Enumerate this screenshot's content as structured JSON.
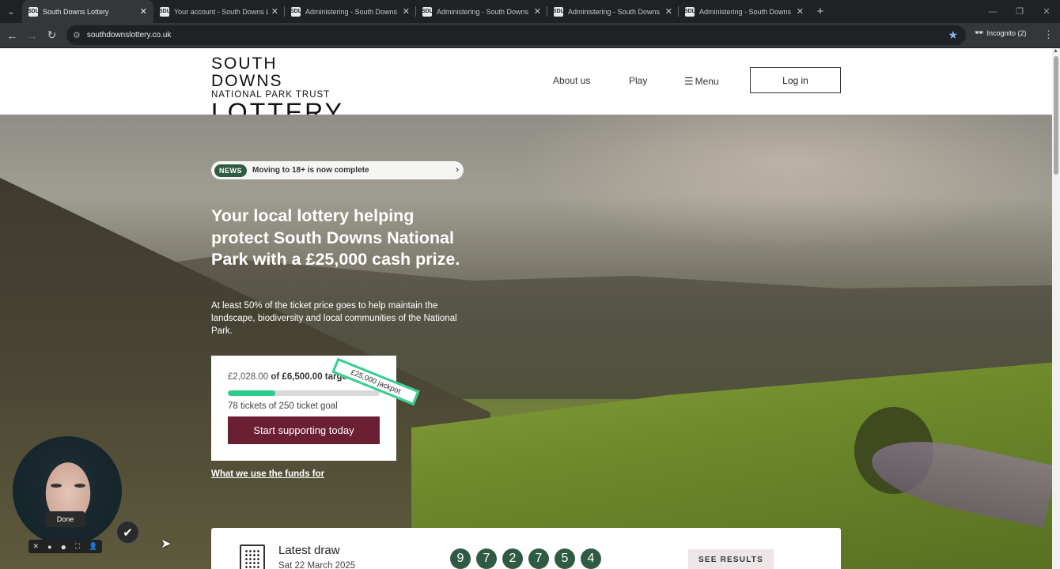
{
  "browser": {
    "tabs": [
      {
        "title": "South Downs Lottery",
        "active": true
      },
      {
        "title": "Your account - South Downs Lo",
        "active": false
      },
      {
        "title": "Administering - South Downs L",
        "active": false
      },
      {
        "title": "Administering - South Downs L",
        "active": false
      },
      {
        "title": "Administering - South Downs L",
        "active": false
      },
      {
        "title": "Administering - South Downs L",
        "active": false
      }
    ],
    "favicon_text": "SDL",
    "url": "southdownslottery.co.uk",
    "incognito_label": "Incognito (2)"
  },
  "header": {
    "logo_line1": "SOUTH DOWNS",
    "logo_line2": "NATIONAL PARK TRUST",
    "logo_line3": "LOTTERY",
    "nav_about": "About us",
    "nav_play": "Play",
    "nav_menu": "Menu",
    "login": "Log in"
  },
  "hero": {
    "news_badge": "NEWS",
    "news_text": "Moving to 18+ is now complete",
    "title": "Your local lottery helping protect South Downs National Park with a £25,000 cash prize.",
    "subtitle": "At least 50% of the ticket price goes to help maintain the landscape, biodiversity and local communities of the National Park.",
    "raised": "£2,028.00",
    "target": "of £6,500.00 target",
    "progress_fraction": 0.31,
    "tickets": "78 tickets of 250 ticket goal",
    "cta": "Start supporting today",
    "jackpot_ribbon": "£25,000 jackpot",
    "funds_link": "What we use the funds for"
  },
  "draw": {
    "title": "Latest draw",
    "date": "Sat 22 March 2025",
    "numbers": [
      "9",
      "7",
      "2",
      "7",
      "5",
      "4"
    ],
    "results_button": "SEE RESULTS"
  },
  "recorder": {
    "done_label": "Done"
  },
  "colors": {
    "brand_green": "#2f5b45",
    "cta_maroon": "#6b1f33",
    "progress_green": "#2ecc8a"
  }
}
